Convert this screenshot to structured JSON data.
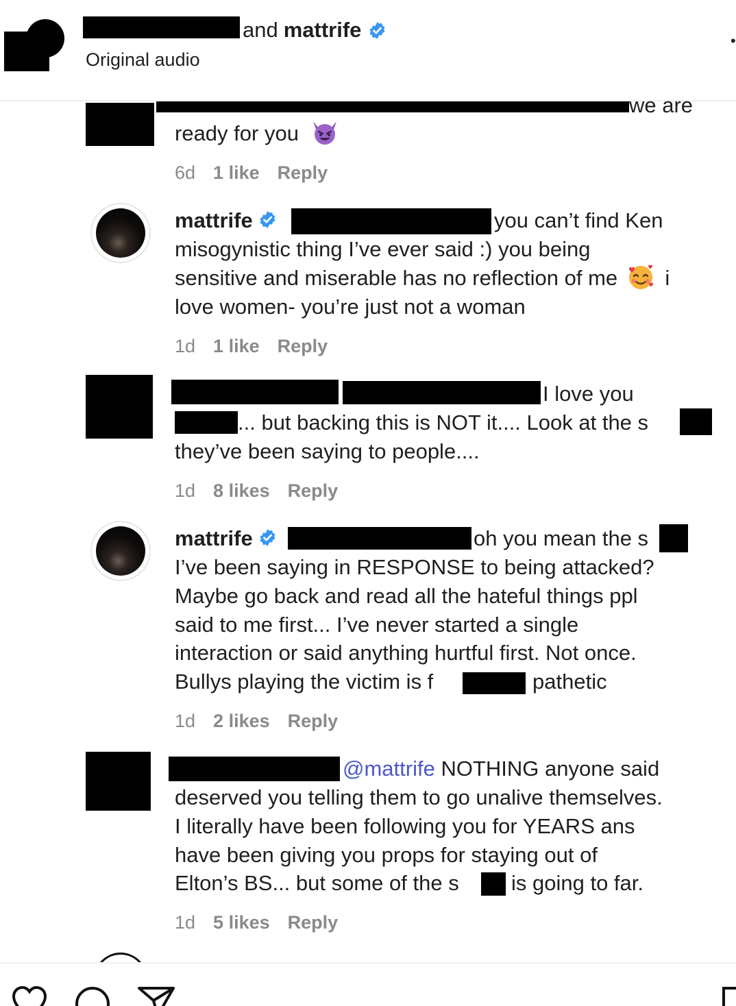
{
  "header": {
    "connector": "and",
    "username": "mattrife",
    "subtitle": "Original audio"
  },
  "comments": [
    {
      "line0_tail": "we are",
      "line1": "ready for you",
      "emoji": "devil-emoji",
      "meta": {
        "age": "6d",
        "likes": "1 like",
        "reply": "Reply"
      }
    },
    {
      "username": "mattrife",
      "line1_tail": "you can’t find Ken",
      "line2": "misogynistic thing I’ve ever said :) you being",
      "line3_head": "sensitive and miserable has no reflection of me",
      "line3_tail": "i",
      "line4": "love women- you’re just not a woman",
      "emoji": "smiling-face-with-hearts-emoji",
      "meta": {
        "age": "1d",
        "likes": "1 like",
        "reply": "Reply"
      }
    },
    {
      "line1_tail": "I love you",
      "line2": "... but backing this is NOT it.... Look at the s",
      "line3": "they’ve been saying to people....",
      "meta": {
        "age": "1d",
        "likes": "8 likes",
        "reply": "Reply"
      }
    },
    {
      "username": "mattrife",
      "line1_tail": "oh you mean the s",
      "line2": "I’ve been saying in RESPONSE to being attacked?",
      "line3": "Maybe go back and read all the hateful things ppl",
      "line4": "said to me first... I’ve never started a single",
      "line5": "interaction or said anything hurtful first. Not once.",
      "line6_head": "Bullys playing the victim is f",
      "line6_tail": "pathetic",
      "meta": {
        "age": "1d",
        "likes": "2 likes",
        "reply": "Reply"
      }
    },
    {
      "mention": "@mattrife",
      "line1_tail": "NOTHING anyone said",
      "line2": "deserved you telling them to go unalive themselves.",
      "line3": "I literally have been following you for YEARS ans",
      "line4": "have been giving you props for staying out of",
      "line5_head": "Elton’s BS... but some of the s",
      "line5_tail": "is going to far.",
      "meta": {
        "age": "1d",
        "likes": "5 likes",
        "reply": "Reply"
      }
    }
  ],
  "colors": {
    "verified": "#3897f0",
    "mention": "#4b57c9",
    "meta": "#8a8a8a"
  },
  "icons": [
    "heart-icon",
    "comment-icon",
    "share-icon",
    "save-icon"
  ]
}
